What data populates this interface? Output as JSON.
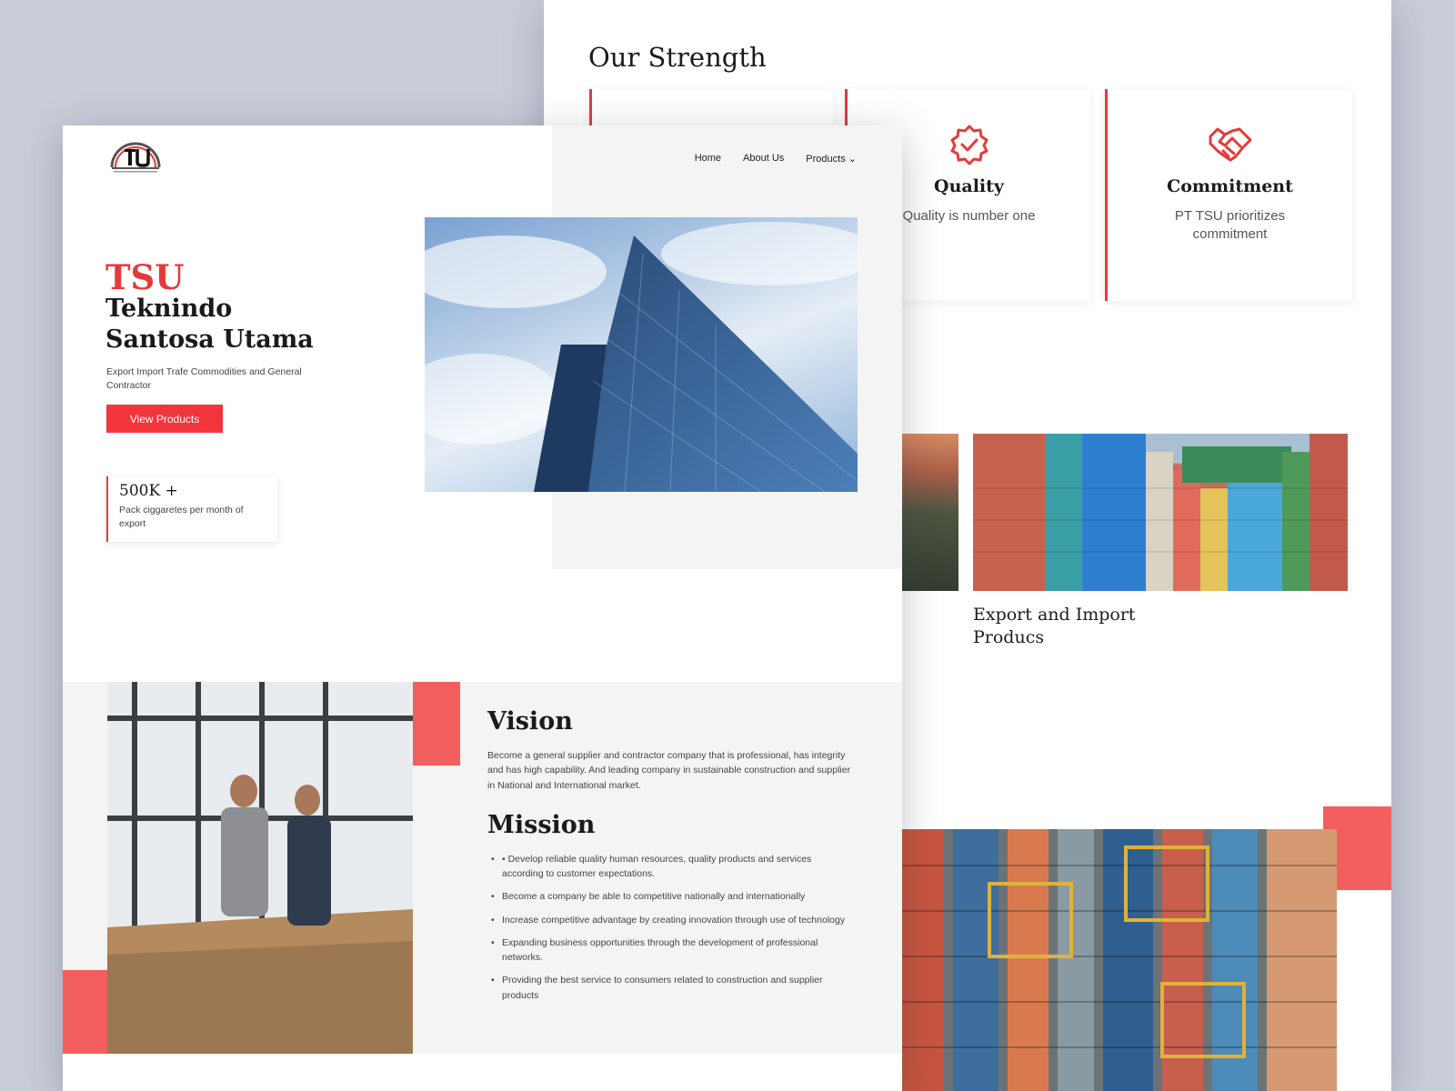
{
  "back_page": {
    "strength_title": "Our Strength",
    "cards": [
      {
        "title": "",
        "desc": "",
        "icon": "circle-icon"
      },
      {
        "title": "Quality",
        "desc": "Quality is number one",
        "icon": "badge-check-icon"
      },
      {
        "title": "Commitment",
        "desc": "PT TSU prioritizes commitment",
        "icon": "handshake-icon"
      }
    ],
    "product_title": "Export and Import Producs"
  },
  "front_page": {
    "nav": {
      "home": "Home",
      "about": "About Us",
      "products": "Products"
    },
    "brand": "TSU",
    "company": "Teknindo Santosa Utama",
    "tagline": "Export Import Trafe Commodities and General Contractor",
    "cta": "View Products",
    "stat": {
      "value": "500K +",
      "label": "Pack ciggaretes per month of export"
    },
    "vision_title": "Vision",
    "vision_text": "Become a general supplier and contractor company that is professional, has integrity and has high capability. And leading company in sustainable construction and supplier in National and International market.",
    "mission_title": "Mission",
    "missions": [
      "• Develop reliable quality human resources, quality products and services according to customer expectations.",
      "Become a company be able to competitive nationally and internationally",
      "Increase competitive advantage by creating innovation through use of technology",
      "Expanding business opportunities through the development of professional networks.",
      "Providing the best service to consumers related to construction and supplier products"
    ]
  },
  "colors": {
    "accent": "#e53a3a",
    "accent_soft": "#f25e5e",
    "background": "#c9cdd8"
  }
}
